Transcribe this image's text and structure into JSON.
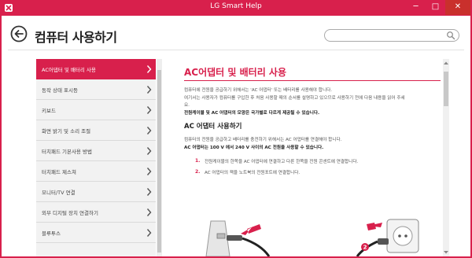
{
  "window": {
    "title": "LG Smart Help",
    "minimize": "─",
    "maximize": "□",
    "close": "✕"
  },
  "header": {
    "title": "컴퓨터 사용하기",
    "search_placeholder": ""
  },
  "sidebar": {
    "items": [
      {
        "label": "AC어댑터 및 배터리 사용",
        "active": true
      },
      {
        "label": "동작 상태 표시등",
        "active": false
      },
      {
        "label": "키보드",
        "active": false
      },
      {
        "label": "화면 밝기 및 소리 조절",
        "active": false
      },
      {
        "label": "터치패드 기본사용 방법",
        "active": false
      },
      {
        "label": "터치패드 제스쳐",
        "active": false
      },
      {
        "label": "모니터/TV 연결",
        "active": false
      },
      {
        "label": "외부 디지털 장치 연결하기",
        "active": false
      },
      {
        "label": "블루투스",
        "active": false
      }
    ]
  },
  "content": {
    "title": "AC어댑터 및 배터리 사용",
    "intro": [
      "컴퓨터에 전원을 공급하기 위해서는 'AC 어댑터' 또는 배터리를 사용해야 합니다.",
      "여기서는 사용자가 컴퓨터를 구입한 후 처음 사용할 때의 순서를 설명하고 있으므로 사용하기 전에 다음 내용을 읽어 주세",
      "요.",
      "전원케이블 및 AC 어댑터의 모양은 국가별로 다르게 제공될 수 있습니다."
    ],
    "section_title": "AC 어댑터 사용하기",
    "section_text": [
      "컴퓨터의 전원을 공급하고 배터리를 충전하기 위해서는 AC 어댑터를 연결해야 합니다.",
      "AC 어댑터는 100 V 에서 240 V 사이의 AC 전원을 사용할 수 있습니다."
    ],
    "steps": [
      {
        "num": "1.",
        "text": "전원케이블의 한쪽을 AC 어댑터에 연결하고 다른 한쪽을 전원 콘센트에 연결합니다."
      },
      {
        "num": "2.",
        "text": "AC 어댑터의 잭을 노트북의 전원포트에 연결합니다."
      }
    ],
    "illustration_badge": "2"
  },
  "colors": {
    "accent": "#d8204c",
    "sidebar_bg": "#f2f2f2"
  },
  "icons": {
    "back": "back-arrow-icon",
    "search": "search-icon",
    "chevron": "chevron-right-icon"
  }
}
